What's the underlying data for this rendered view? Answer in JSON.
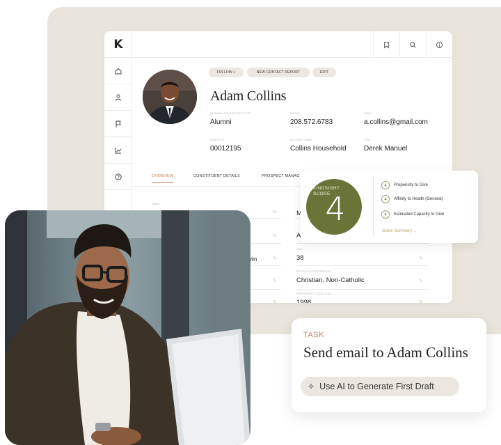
{
  "app": {
    "logo": "K"
  },
  "contact_actions": {
    "follow": "FOLLOW +",
    "new_report": "NEW CONTACT REPORT",
    "edit": "EDIT"
  },
  "contact": {
    "name": "Adam Collins",
    "fields": [
      {
        "label": "PRIMARY CONSTITUENT TYPE",
        "value": "Alumni"
      },
      {
        "label": "PHONE",
        "value": "208.572.6783"
      },
      {
        "label": "EMAIL",
        "value": "a.collins@gmail.com"
      },
      {
        "label": "DONOR ID",
        "value": "00012195"
      },
      {
        "label": "ACCOUNT NAME",
        "value": "Collins Household"
      },
      {
        "label": "TPM",
        "value": "Derek Manuel"
      }
    ]
  },
  "tabs": {
    "overview": "OVERVIEW",
    "details": "CONSTITUENT DETAILS",
    "prospect": "PROSPECT MANAG"
  },
  "details": {
    "name_label": "NAME",
    "m_partial": "M",
    "a_partial": "A",
    "win_partial": "win",
    "age_label": "AGE",
    "age": "38",
    "religion_label": "RELIGIOUS PREFERENCE",
    "religion": "Christian. Non-Catholic",
    "year_label": "PREFERRED CLASS YEAR",
    "year": "1998"
  },
  "kindsight": {
    "label_line1": "KINDSIGHT",
    "label_line2": "SCORE",
    "score": "4",
    "items": [
      {
        "score": "4",
        "label": "Propensity to Give"
      },
      {
        "score": "4",
        "label": "Affinity to Health (General)"
      },
      {
        "score": "4",
        "label": "Estimated Capacity to Give"
      }
    ],
    "summary_link": "Score Summary →"
  },
  "task": {
    "label": "TASK",
    "title": "Send email to Adam Collins",
    "ai_button": "Use AI to Generate First Draft"
  }
}
